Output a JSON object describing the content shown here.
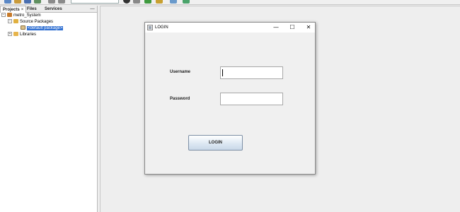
{
  "panel": {
    "tabs": [
      {
        "label": "Projects",
        "close": "×"
      },
      {
        "label": "Files"
      },
      {
        "label": "Services"
      }
    ],
    "minimize_glyph": "—"
  },
  "tree": {
    "project": "metro_System",
    "source_packages": "Source Packages",
    "default_package": "<default package>",
    "libraries": "Libraries",
    "expanded_glyph": "−",
    "collapsed_glyph": "+"
  },
  "dialog": {
    "title": "LOGIN",
    "minimize_glyph": "—",
    "maximize_glyph": "☐",
    "close_glyph": "✕",
    "username_label": "Username",
    "username_value": "",
    "password_label": "Password",
    "password_value": "",
    "login_label": "LOGIN"
  },
  "colors": {
    "selection": "#2f6fd1",
    "button_top": "#ffffff",
    "button_bottom": "#c9d8e8"
  }
}
